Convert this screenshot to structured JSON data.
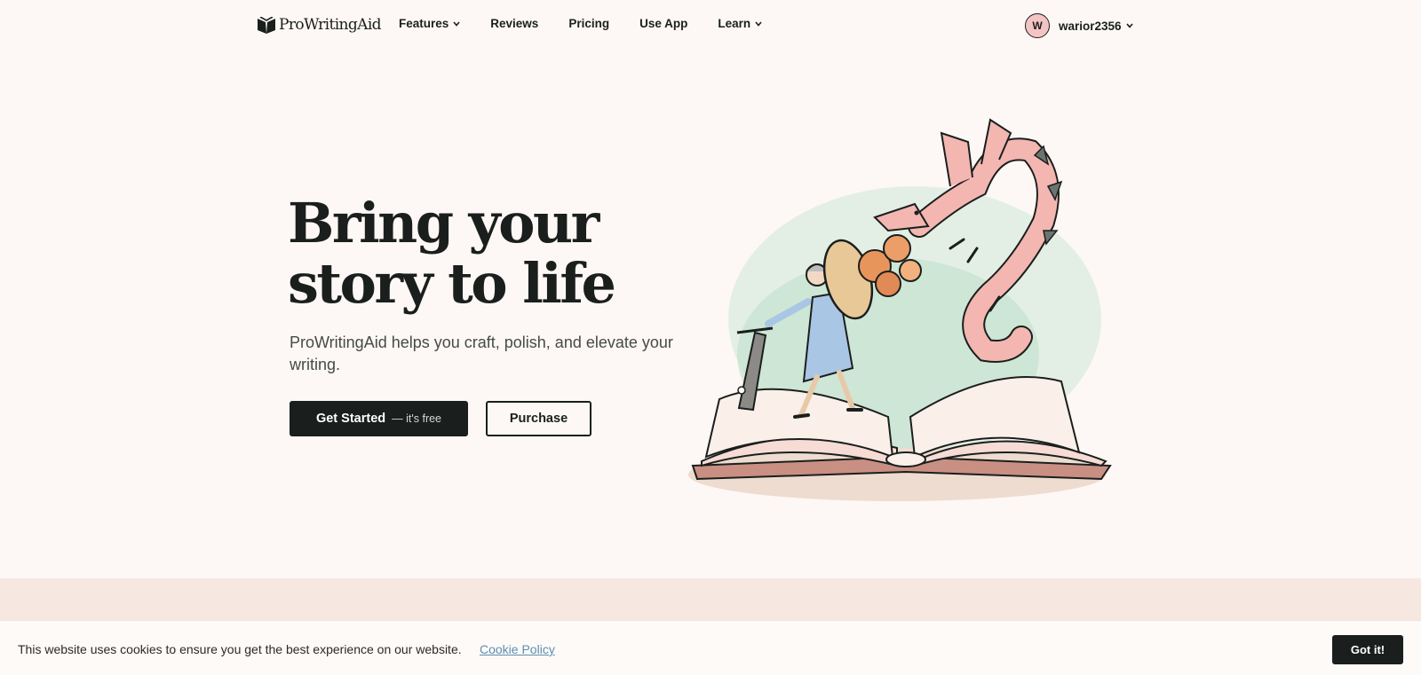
{
  "nav": {
    "logo_text": "ProWritingAid",
    "items": [
      {
        "label": "Features",
        "dropdown": true
      },
      {
        "label": "Reviews",
        "dropdown": false
      },
      {
        "label": "Pricing",
        "dropdown": false
      },
      {
        "label": "Use App",
        "dropdown": false
      },
      {
        "label": "Learn",
        "dropdown": true
      }
    ],
    "user": {
      "initial": "W",
      "name": "warior2356"
    }
  },
  "hero": {
    "headline_line1": "Bring your",
    "headline_line2": "story to life",
    "subhead": "ProWritingAid helps you craft, polish, and elevate your writing.",
    "primary_button": {
      "label": "Get Started",
      "sublabel": "— it's free"
    },
    "secondary_button": {
      "label": "Purchase"
    },
    "illustration": "knight-fighting-dragon-on-open-book"
  },
  "cookie_banner": {
    "text": "This website uses cookies to ensure you get the best experience on our website.",
    "link": "Cookie Policy",
    "button": "Got it!"
  },
  "colors": {
    "background": "#fdf8f5",
    "ink": "#1a1f1d",
    "band": "#f6e8e1",
    "avatar": "#f3c4c3",
    "link": "#5b8fb0"
  }
}
